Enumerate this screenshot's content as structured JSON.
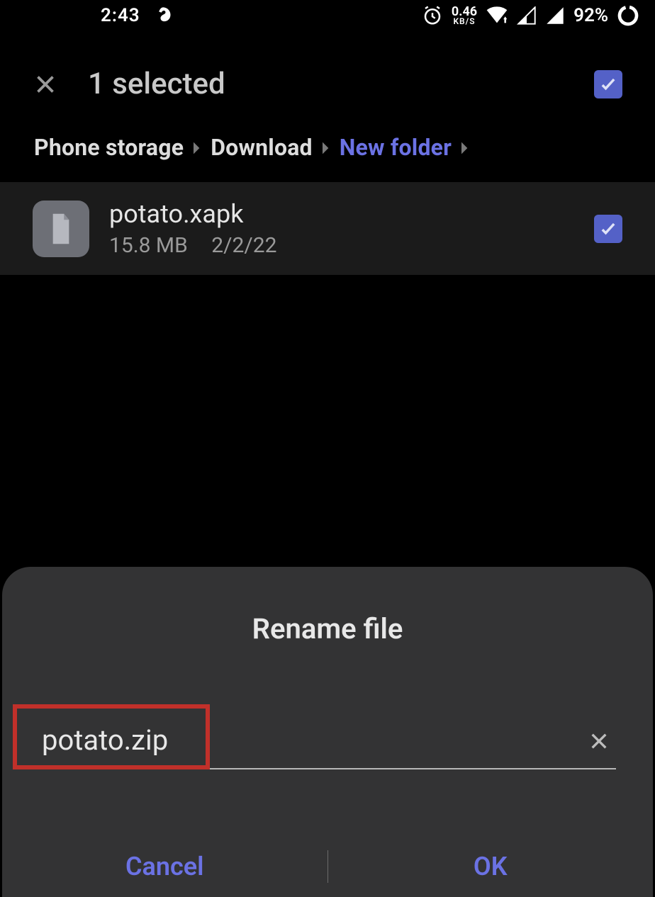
{
  "status": {
    "time": "2:43",
    "net_speed_value": "0.46",
    "net_speed_unit": "KB/S",
    "battery_pct": "92%"
  },
  "header": {
    "title": "1 selected"
  },
  "breadcrumb": {
    "root": "Phone storage",
    "mid": "Download",
    "leaf": "New folder"
  },
  "file": {
    "name": "potato.xapk",
    "size": "15.8 MB",
    "date": "2/2/22"
  },
  "dialog": {
    "title": "Rename file",
    "input_value": "potato.zip",
    "cancel": "Cancel",
    "ok": "OK"
  }
}
